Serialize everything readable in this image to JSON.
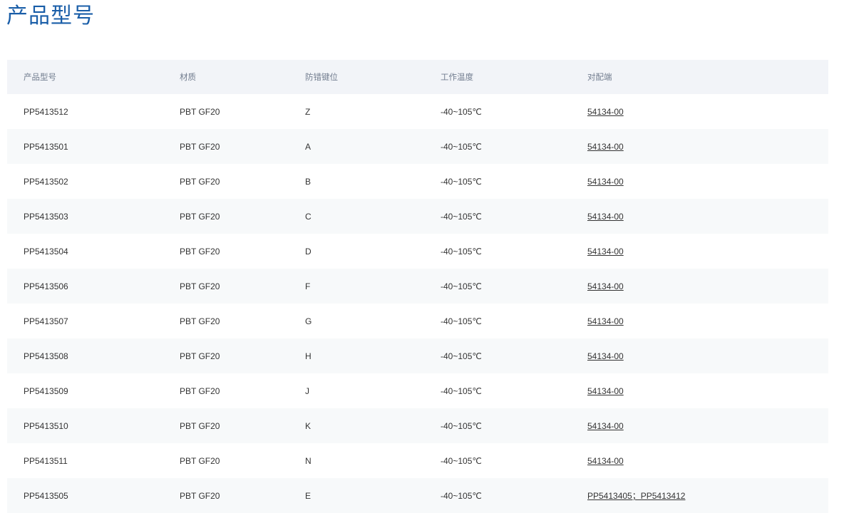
{
  "page": {
    "title": "产品型号"
  },
  "table": {
    "headers": [
      "产品型号",
      "材质",
      "防错键位",
      "工作温度",
      "对配端"
    ],
    "rows": [
      {
        "model": "PP5413512",
        "material": "PBT GF20",
        "key": "Z",
        "temp": "-40~105℃",
        "mate": "54134-00"
      },
      {
        "model": "PP5413501",
        "material": "PBT GF20",
        "key": "A",
        "temp": "-40~105℃",
        "mate": "54134-00"
      },
      {
        "model": "PP5413502",
        "material": "PBT GF20",
        "key": "B",
        "temp": "-40~105℃",
        "mate": "54134-00"
      },
      {
        "model": "PP5413503",
        "material": "PBT GF20",
        "key": "C",
        "temp": "-40~105℃",
        "mate": "54134-00"
      },
      {
        "model": "PP5413504",
        "material": "PBT GF20",
        "key": "D",
        "temp": "-40~105℃",
        "mate": "54134-00"
      },
      {
        "model": "PP5413506",
        "material": "PBT GF20",
        "key": "F",
        "temp": "-40~105℃",
        "mate": "54134-00"
      },
      {
        "model": "PP5413507",
        "material": "PBT GF20",
        "key": "G",
        "temp": "-40~105℃",
        "mate": "54134-00"
      },
      {
        "model": "PP5413508",
        "material": "PBT GF20",
        "key": "H",
        "temp": "-40~105℃",
        "mate": "54134-00"
      },
      {
        "model": "PP5413509",
        "material": "PBT GF20",
        "key": "J",
        "temp": "-40~105℃",
        "mate": "54134-00"
      },
      {
        "model": "PP5413510",
        "material": "PBT GF20",
        "key": "K",
        "temp": "-40~105℃",
        "mate": "54134-00"
      },
      {
        "model": "PP5413511",
        "material": "PBT GF20",
        "key": "N",
        "temp": "-40~105℃",
        "mate": "54134-00"
      },
      {
        "model": "PP5413505",
        "material": "PBT GF20",
        "key": "E",
        "temp": "-40~105℃",
        "mate": "PP5413405；PP5413412"
      }
    ]
  },
  "colors": {
    "title": "#1a5ea8",
    "header_bg": "#f2f4f8",
    "header_text": "#727d8f",
    "stripe_bg": "#f7f9fa",
    "body_text": "#333333"
  }
}
